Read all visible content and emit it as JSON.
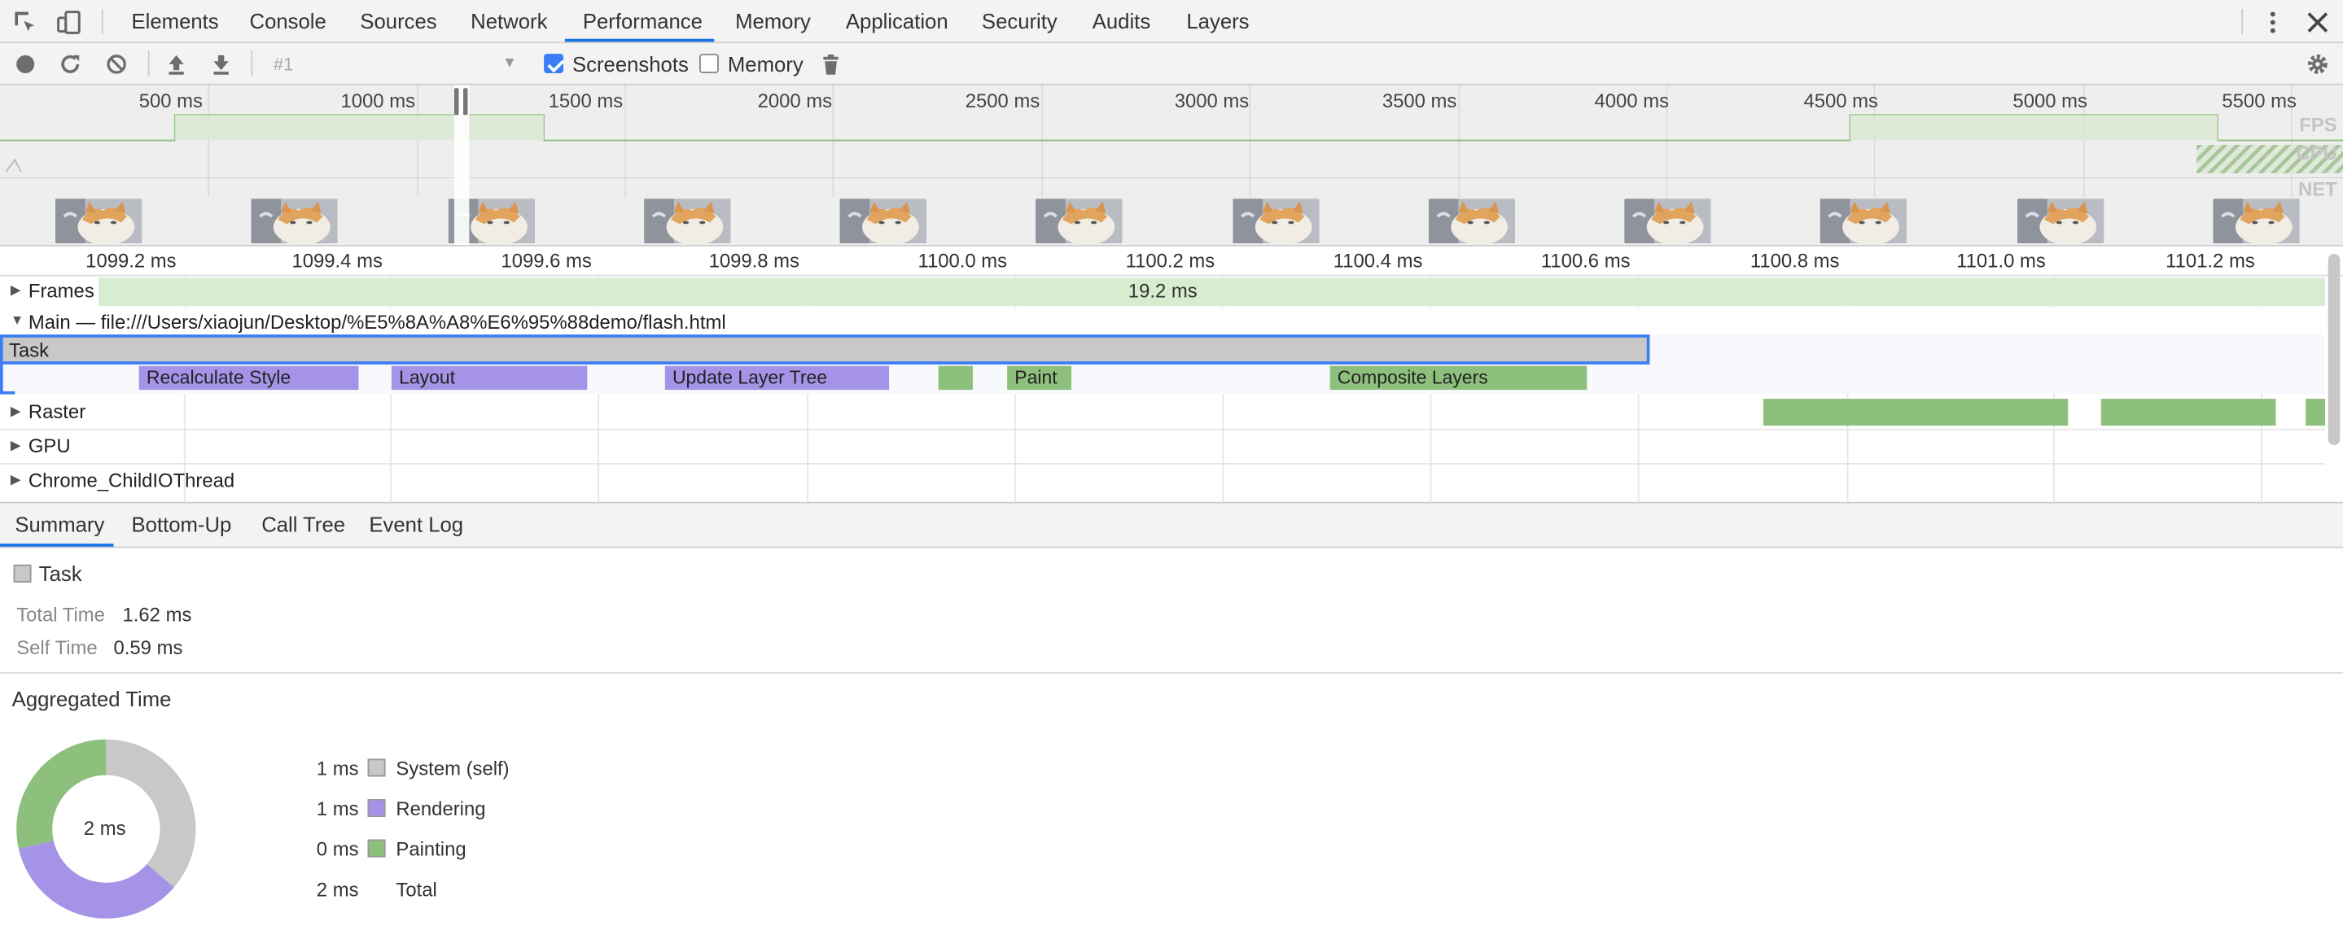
{
  "tabs": [
    {
      "label": "Elements"
    },
    {
      "label": "Console"
    },
    {
      "label": "Sources"
    },
    {
      "label": "Network"
    },
    {
      "label": "Performance",
      "active": true
    },
    {
      "label": "Memory"
    },
    {
      "label": "Application"
    },
    {
      "label": "Security"
    },
    {
      "label": "Audits"
    },
    {
      "label": "Layers"
    }
  ],
  "toolbar": {
    "session_label": "#1",
    "screenshots_label": "Screenshots",
    "screenshots_checked": true,
    "memory_label": "Memory",
    "memory_checked": false
  },
  "overview": {
    "ticks": [
      "500 ms",
      "1000 ms",
      "1500 ms",
      "2000 ms",
      "2500 ms",
      "3000 ms",
      "3500 ms",
      "4000 ms",
      "4500 ms",
      "5000 ms",
      "5500 ms"
    ],
    "lane_labels": {
      "fps": "FPS",
      "cpu": "CPU",
      "net": "NET"
    }
  },
  "ruler": {
    "ticks": [
      "1099.2 ms",
      "1099.4 ms",
      "1099.6 ms",
      "1099.8 ms",
      "1100.0 ms",
      "1100.2 ms",
      "1100.4 ms",
      "1100.6 ms",
      "1100.8 ms",
      "1101.0 ms",
      "1101.2 ms"
    ]
  },
  "tracks": {
    "frames": {
      "label": "Frames",
      "frame_duration": "19.2 ms"
    },
    "main": {
      "label": "Main — file:///Users/xiaojun/Desktop/%E5%8A%A8%E6%95%88demo/flash.html"
    },
    "task": {
      "label": "Task"
    },
    "events": [
      {
        "label": "Recalculate Style"
      },
      {
        "label": "Layout"
      },
      {
        "label": "Update Layer Tree"
      },
      {
        "label": ""
      },
      {
        "label": "Paint"
      },
      {
        "label": "Composite Layers"
      }
    ],
    "raster": {
      "label": "Raster"
    },
    "gpu": {
      "label": "GPU"
    },
    "childio": {
      "label": "Chrome_ChildIOThread"
    }
  },
  "bottom_tabs": [
    {
      "label": "Summary",
      "active": true
    },
    {
      "label": "Bottom-Up"
    },
    {
      "label": "Call Tree"
    },
    {
      "label": "Event Log"
    }
  ],
  "summary": {
    "title": "Task",
    "total_time_label": "Total Time",
    "total_time": "1.62 ms",
    "self_time_label": "Self Time",
    "self_time": "0.59 ms",
    "aggregated_title": "Aggregated Time",
    "donut_center": "2 ms",
    "legend": [
      {
        "value": "1 ms",
        "name": "System (self)",
        "color": "#c8c8c8"
      },
      {
        "value": "1 ms",
        "name": "Rendering",
        "color": "#a493e7"
      },
      {
        "value": "0 ms",
        "name": "Painting",
        "color": "#8ec07d"
      },
      {
        "value": "2 ms",
        "name": "Total",
        "color": ""
      }
    ]
  },
  "colors": {
    "accent": "#1a73e8",
    "rendering": "#a493e7",
    "painting": "#8ec07d",
    "system": "#c8c8c8",
    "frames": "#d8ecd0"
  }
}
